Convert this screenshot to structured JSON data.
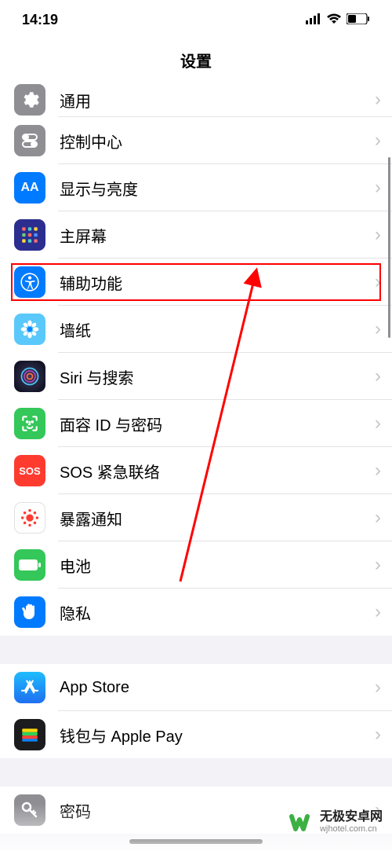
{
  "status": {
    "time": "14:19"
  },
  "header": {
    "title": "设置"
  },
  "group1": [
    {
      "id": "general",
      "label": "通用",
      "bg": "#8e8e93"
    },
    {
      "id": "control-center",
      "label": "控制中心",
      "bg": "#8e8e93"
    },
    {
      "id": "display",
      "label": "显示与亮度",
      "bg": "#007aff"
    },
    {
      "id": "home-screen",
      "label": "主屏幕",
      "bg": "#3a3a8c"
    },
    {
      "id": "accessibility",
      "label": "辅助功能",
      "bg": "#007aff",
      "hl": true
    },
    {
      "id": "wallpaper",
      "label": "墙纸",
      "bg": "#5ac8fa"
    },
    {
      "id": "siri",
      "label": "Siri 与搜索",
      "bg": "#1c1c1e"
    },
    {
      "id": "faceid",
      "label": "面容 ID 与密码",
      "bg": "#34c759"
    },
    {
      "id": "sos",
      "label": "SOS 紧急联络",
      "bg": "#ff3b30",
      "text": "SOS"
    },
    {
      "id": "exposure",
      "label": "暴露通知",
      "bg": "#ffffff"
    },
    {
      "id": "battery",
      "label": "电池",
      "bg": "#34c759"
    },
    {
      "id": "privacy",
      "label": "隐私",
      "bg": "#007aff"
    }
  ],
  "group2": [
    {
      "id": "app-store",
      "label": "App Store",
      "bg": "#1e90ff"
    },
    {
      "id": "wallet",
      "label": "钱包与 Apple Pay",
      "bg": "#1c1c1e"
    }
  ],
  "group3": [
    {
      "id": "passwords",
      "label": "密码",
      "bg": "#8e8e93"
    }
  ],
  "watermark": {
    "title": "无极安卓网",
    "url": "wjhotel.com.cn"
  }
}
